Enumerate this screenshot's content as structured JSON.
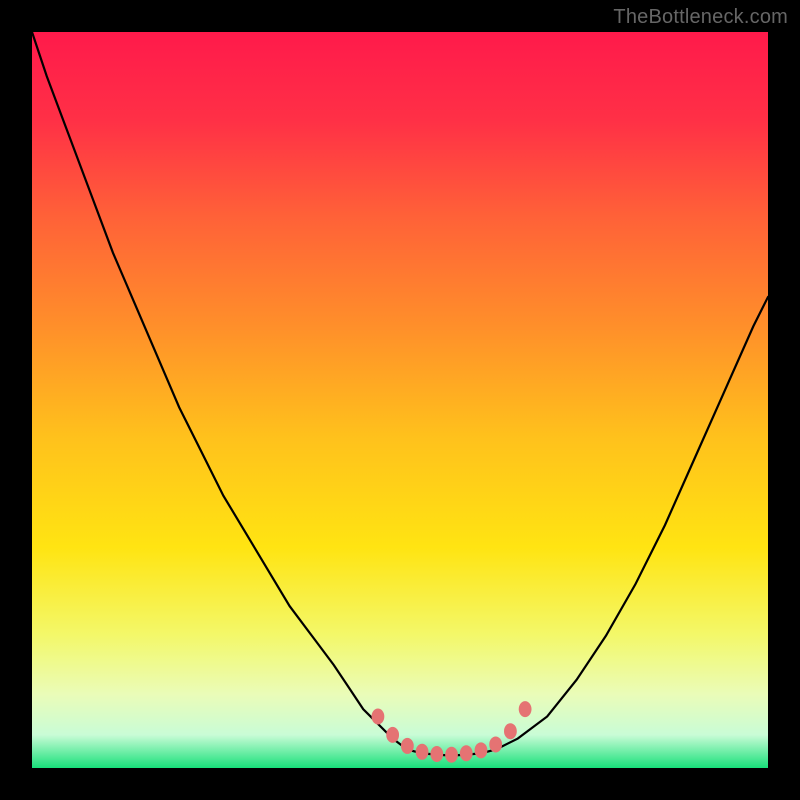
{
  "watermark": "TheBottleneck.com",
  "chart_data": {
    "type": "line",
    "title": "",
    "xlabel": "",
    "ylabel": "",
    "xlim": [
      0,
      100
    ],
    "ylim": [
      0,
      100
    ],
    "grid": false,
    "background_gradient_stops": [
      {
        "offset": 0.0,
        "color": "#ff1a4b"
      },
      {
        "offset": 0.12,
        "color": "#ff3046"
      },
      {
        "offset": 0.25,
        "color": "#ff6138"
      },
      {
        "offset": 0.4,
        "color": "#ff8f2a"
      },
      {
        "offset": 0.55,
        "color": "#ffc11c"
      },
      {
        "offset": 0.7,
        "color": "#ffe412"
      },
      {
        "offset": 0.82,
        "color": "#f3f86a"
      },
      {
        "offset": 0.9,
        "color": "#eafcb8"
      },
      {
        "offset": 0.955,
        "color": "#c9fcd6"
      },
      {
        "offset": 1.0,
        "color": "#18e07a"
      }
    ],
    "series": [
      {
        "name": "left-curve",
        "color": "#000000",
        "x": [
          0,
          2,
          5,
          8,
          11,
          14,
          17,
          20,
          23,
          26,
          29,
          32,
          35,
          38,
          41,
          43,
          45,
          47,
          49,
          51,
          53
        ],
        "y": [
          100,
          94,
          86,
          78,
          70,
          63,
          56,
          49,
          43,
          37,
          32,
          27,
          22,
          18,
          14,
          11,
          8,
          6,
          4,
          2.5,
          2
        ]
      },
      {
        "name": "bottom-flat",
        "color": "#000000",
        "x": [
          53,
          55,
          57,
          59,
          61,
          63
        ],
        "y": [
          2,
          1.8,
          1.7,
          1.8,
          2,
          2.5
        ]
      },
      {
        "name": "right-curve",
        "color": "#000000",
        "x": [
          63,
          66,
          70,
          74,
          78,
          82,
          86,
          90,
          94,
          98,
          100
        ],
        "y": [
          2.5,
          4,
          7,
          12,
          18,
          25,
          33,
          42,
          51,
          60,
          64
        ]
      }
    ],
    "markers": {
      "name": "valley-markers",
      "color": "#e57373",
      "radius_px": 8,
      "points": [
        {
          "x": 47,
          "y": 7
        },
        {
          "x": 49,
          "y": 4.5
        },
        {
          "x": 51,
          "y": 3
        },
        {
          "x": 53,
          "y": 2.2
        },
        {
          "x": 55,
          "y": 1.9
        },
        {
          "x": 57,
          "y": 1.8
        },
        {
          "x": 59,
          "y": 2
        },
        {
          "x": 61,
          "y": 2.4
        },
        {
          "x": 63,
          "y": 3.2
        },
        {
          "x": 65,
          "y": 5
        },
        {
          "x": 67,
          "y": 8
        }
      ]
    }
  }
}
